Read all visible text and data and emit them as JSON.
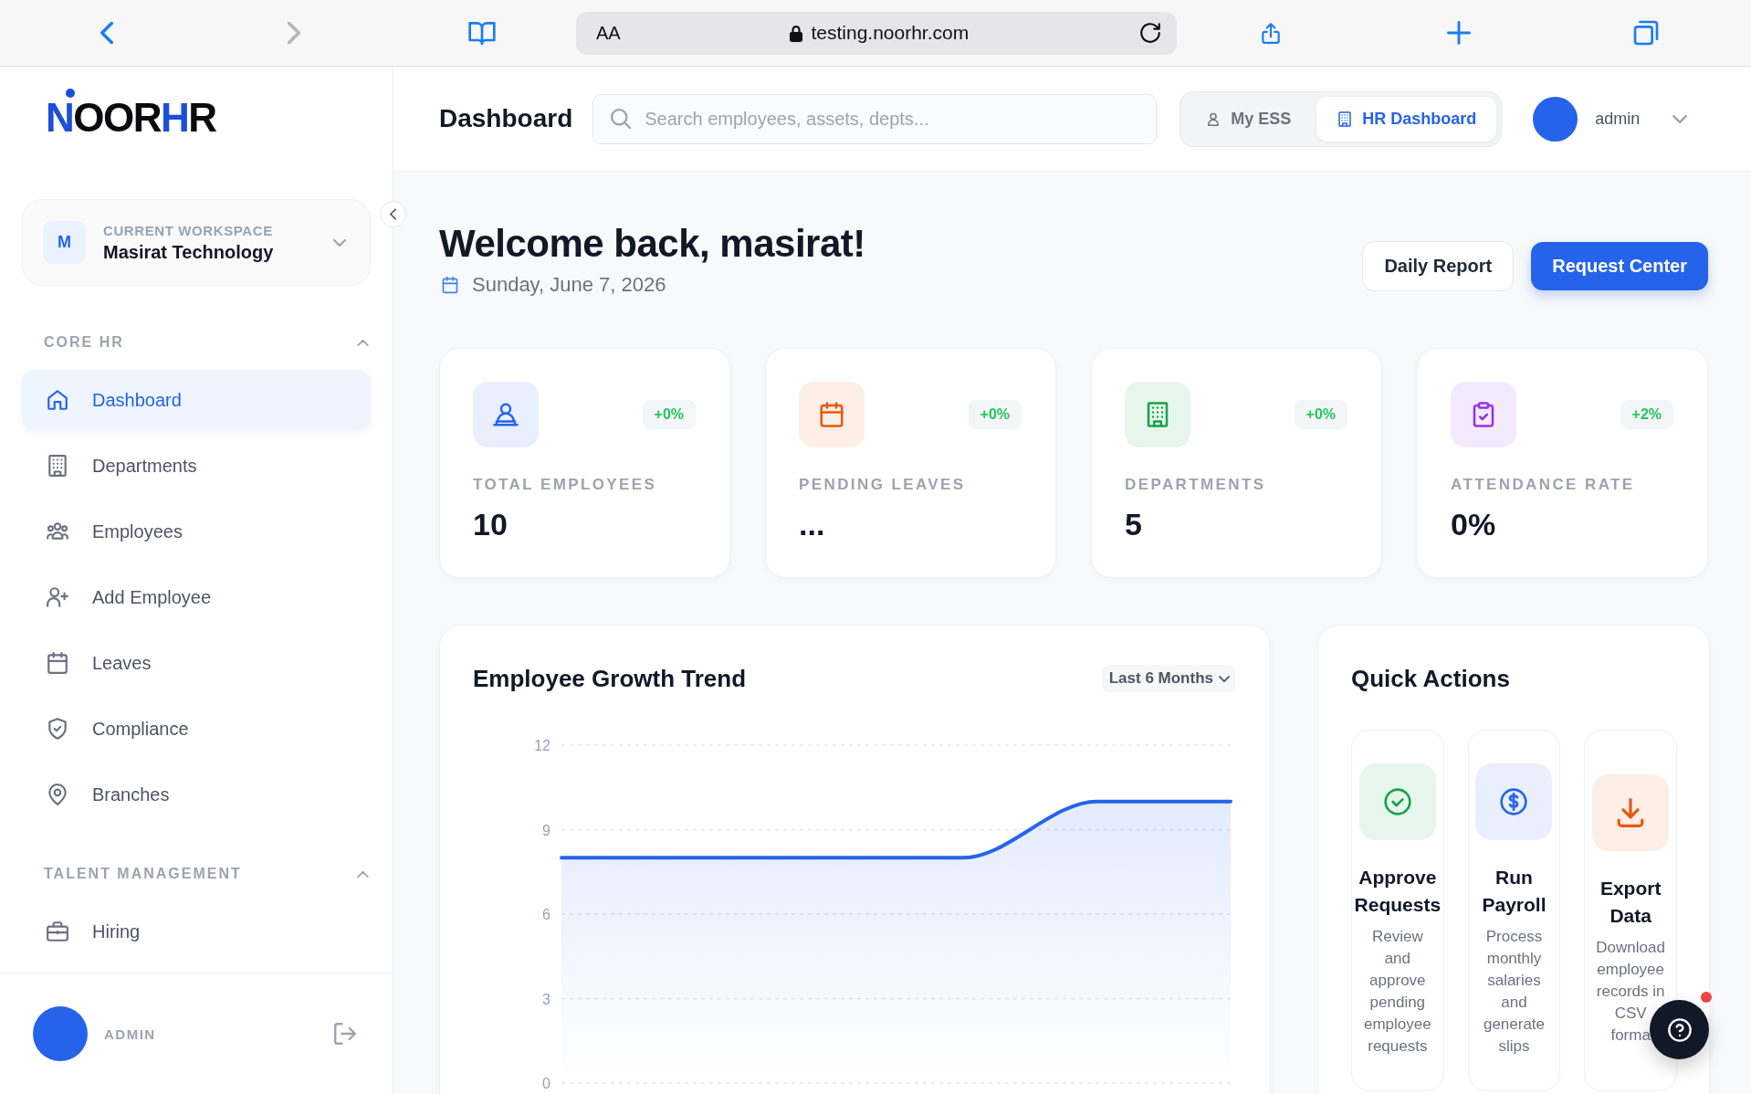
{
  "browser": {
    "text_size": "AA",
    "url": "testing.noorhr.com",
    "back_disabled": false,
    "forward_disabled": true
  },
  "sidebar": {
    "logo": [
      {
        "text": "N",
        "kind": "accent"
      },
      {
        "text": "OOR",
        "kind": "plain"
      },
      {
        "text": "H",
        "kind": "accent"
      },
      {
        "text": "R",
        "kind": "plain"
      }
    ],
    "workspace": {
      "initial": "M",
      "caption": "CURRENT WORKSPACE",
      "name": "Masirat Technology"
    },
    "sections": [
      {
        "title": "CORE HR",
        "expanded": true,
        "items": [
          {
            "label": "Dashboard",
            "selected": true
          },
          {
            "label": "Departments",
            "selected": false
          },
          {
            "label": "Employees",
            "selected": false
          },
          {
            "label": "Add Employee",
            "selected": false
          },
          {
            "label": "Leaves",
            "selected": false
          },
          {
            "label": "Compliance",
            "selected": false
          },
          {
            "label": "Branches",
            "selected": false
          }
        ]
      },
      {
        "title": "TALENT MANAGEMENT",
        "expanded": true,
        "items": [
          {
            "label": "Hiring",
            "selected": false
          }
        ]
      }
    ],
    "user": {
      "name": "ADMIN"
    }
  },
  "header": {
    "title": "Dashboard",
    "search": {
      "placeholder": "Search employees, assets, depts..."
    },
    "views": [
      {
        "label": "My ESS",
        "selected": false
      },
      {
        "label": "HR Dashboard",
        "selected": true
      }
    ],
    "user": {
      "name": "admin"
    }
  },
  "welcome": {
    "title": "Welcome back, masirat!",
    "date": "Sunday, June 7, 2026",
    "buttons": [
      {
        "label": "Daily Report",
        "kind": "secondary"
      },
      {
        "label": "Request Center",
        "kind": "primary"
      }
    ]
  },
  "stats": [
    {
      "label": "TOTAL EMPLOYEES",
      "value": "10",
      "change": "+0%",
      "color": "#2563eb"
    },
    {
      "label": "PENDING LEAVES",
      "value": "...",
      "change": "+0%",
      "color": "#ea580c"
    },
    {
      "label": "DEPARTMENTS",
      "value": "5",
      "change": "+0%",
      "color": "#16a34a"
    },
    {
      "label": "ATTENDANCE RATE",
      "value": "0%",
      "change": "+2%",
      "color": "#9333ea"
    }
  ],
  "growth_chart": {
    "title": "Employee Growth Trend",
    "range": "Last 6 Months",
    "chart_data": {
      "type": "area",
      "ylim": [
        0,
        12
      ],
      "yticks": [
        0,
        3,
        6,
        9,
        12
      ],
      "grid": true,
      "values": [
        8,
        8,
        8,
        8,
        10,
        10
      ]
    }
  },
  "quick_actions": {
    "title": "Quick Actions",
    "items": [
      {
        "title": "Approve Requests",
        "description": "Review and approve pending employee requests",
        "color": "#16a34a"
      },
      {
        "title": "Run Payroll",
        "description": "Process monthly salaries and generate slips",
        "color": "#2563eb"
      },
      {
        "title": "Export Data",
        "description": "Download employee records in CSV forma",
        "color": "#ea580c"
      }
    ]
  },
  "help_button": {
    "notification": true
  }
}
